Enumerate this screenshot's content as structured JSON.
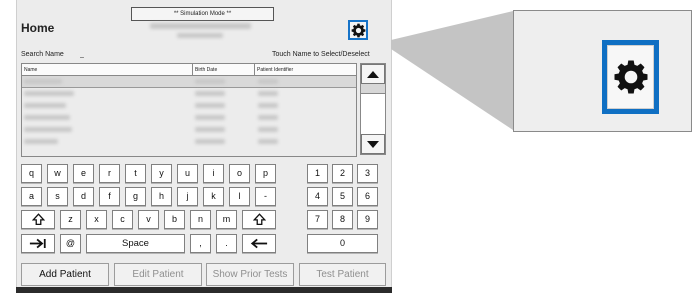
{
  "header": {
    "title": "Home",
    "simulation_banner": "** Simulation Mode **"
  },
  "search": {
    "label": "Search Name",
    "value": "_",
    "hint": "Touch Name to Select/Deselect"
  },
  "patient_table": {
    "columns": [
      "Name",
      "Birth Date",
      "Patient Identifier"
    ],
    "rows": [
      {
        "selected": true
      },
      {},
      {},
      {},
      {},
      {}
    ]
  },
  "keyboard": {
    "row1": [
      "q",
      "w",
      "e",
      "r",
      "t",
      "y",
      "u",
      "i",
      "o",
      "p"
    ],
    "row2": [
      "a",
      "s",
      "d",
      "f",
      "g",
      "h",
      "j",
      "k",
      "l",
      "-"
    ],
    "row3": [
      "z",
      "x",
      "c",
      "v",
      "b",
      "n",
      "m"
    ],
    "row4_labels": {
      "at": "@",
      "space": "Space",
      "comma": ",",
      "period": "."
    },
    "numpad": [
      "1",
      "2",
      "3",
      "4",
      "5",
      "6",
      "7",
      "8",
      "9",
      "0"
    ]
  },
  "actions": {
    "add_patient": "Add Patient",
    "edit_patient": "Edit Patient",
    "show_prior_tests": "Show Prior Tests",
    "test_patient": "Test Patient"
  },
  "icons": {
    "settings": "gear-icon",
    "shift": "shift-icon",
    "tab": "tab-icon",
    "backspace": "backspace-icon",
    "scroll_up": "arrow-up-icon",
    "scroll_down": "arrow-down-icon"
  },
  "colors": {
    "accent": "#1673c8"
  }
}
